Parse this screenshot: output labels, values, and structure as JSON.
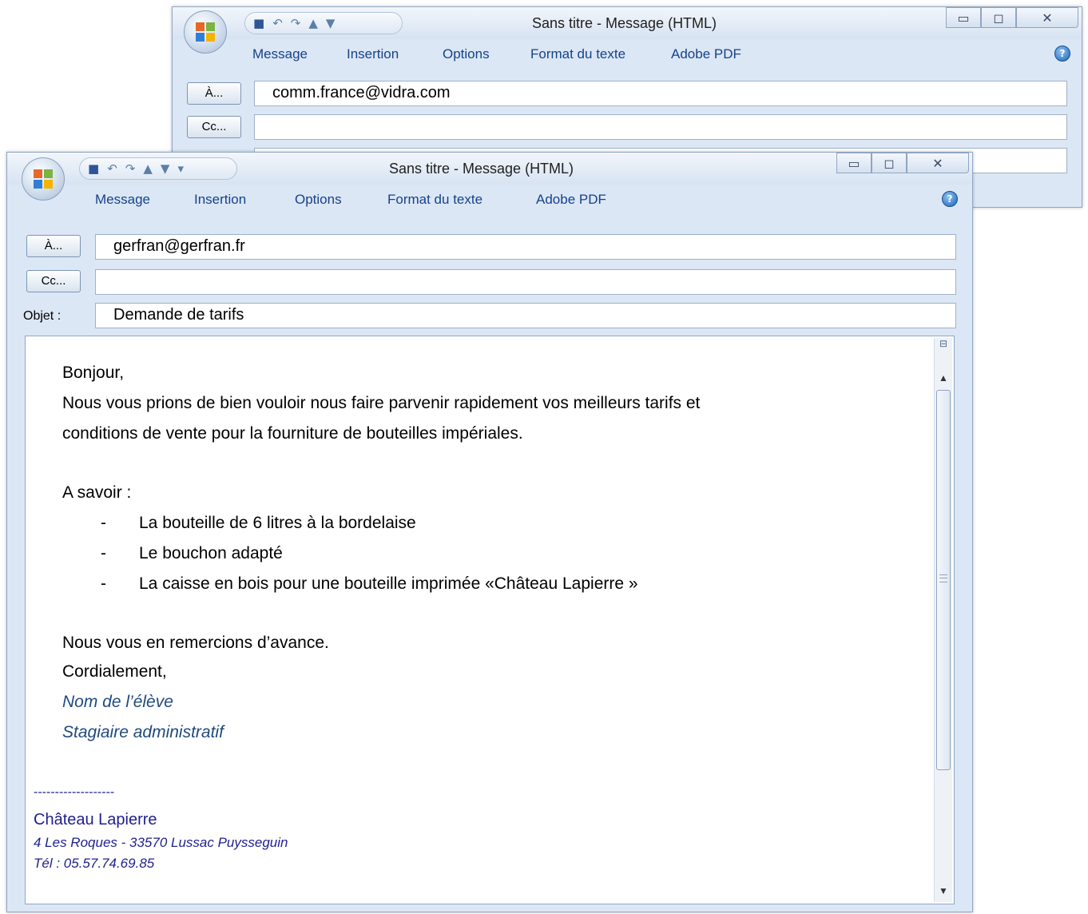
{
  "back_window": {
    "title": "Sans titre - Message (HTML)",
    "tabs": [
      "Message",
      "Insertion",
      "Options",
      "Format du texte",
      "Adobe PDF"
    ],
    "to_button": "À...",
    "cc_button": "Cc...",
    "to_value": "comm.france@vidra.com",
    "cc_value": ""
  },
  "front_window": {
    "title": "Sans titre - Message (HTML)",
    "tabs": [
      "Message",
      "Insertion",
      "Options",
      "Format du texte",
      "Adobe PDF"
    ],
    "to_button": "À...",
    "cc_button": "Cc...",
    "subject_label": "Objet :",
    "to_value": "gerfran@gerfran.fr",
    "cc_value": "",
    "subject_value": "Demande de tarifs",
    "body": {
      "greeting": "Bonjour,",
      "line1": "Nous vous prions de bien vouloir nous faire parvenir rapidement vos meilleurs tarifs et",
      "line2": "conditions de vente pour la fourniture de bouteilles impériales.",
      "a_savoir": "A savoir :",
      "bullet_marker": "-",
      "items": [
        "La bouteille de 6 litres à la bordelaise",
        "Le bouchon adapté",
        "La caisse en bois pour une bouteille imprimée «Château Lapierre »"
      ],
      "thanks": "Nous vous en remercions d’avance.",
      "closing": "Cordialement,",
      "name": "Nom de l’élève",
      "role": "Stagiaire administratif"
    },
    "signature": {
      "dashes": "-------------------",
      "company": "Château Lapierre",
      "address": "4 Les Roques - 33570 Lussac Puysseguin",
      "phone": "Tél : 05.57.74.69.85"
    }
  },
  "icons": [
    "office-button-icon",
    "save-icon",
    "undo-icon",
    "redo-icon",
    "up-arrow-icon",
    "down-arrow-icon",
    "customize-qat-icon",
    "minimize-icon",
    "maximize-icon",
    "close-icon",
    "help-icon",
    "split-icon",
    "scroll-up-icon",
    "scroll-down-icon"
  ],
  "colors": {
    "ribbon_text": "#15428b",
    "signature_blue": "#1f497d",
    "window_bg": "#dce7f5"
  }
}
